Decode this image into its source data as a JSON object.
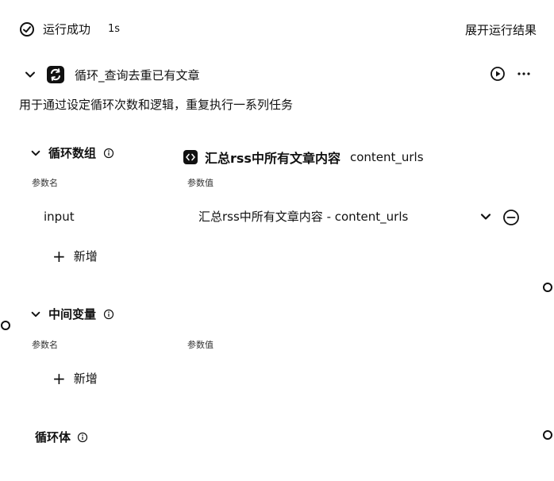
{
  "status": {
    "label": "运行成功",
    "duration": "1s",
    "expand_results": "展开运行结果"
  },
  "node": {
    "title": "循环_查询去重已有文章",
    "description": "用于通过设定循环次数和逻辑，重复执行一系列任务"
  },
  "loop_array": {
    "title": "循环数组",
    "param_name_header": "参数名",
    "param_value_header": "参数值",
    "tooltip_source": "汇总rss中所有文章内容",
    "tooltip_field": "content_urls",
    "rows": [
      {
        "name": "input",
        "value": "汇总rss中所有文章内容 - content_urls"
      }
    ],
    "add_label": "新增"
  },
  "intermediate_vars": {
    "title": "中间变量",
    "param_name_header": "参数名",
    "param_value_header": "参数值",
    "add_label": "新增"
  },
  "loop_body": {
    "title": "循环体"
  },
  "colors": {
    "text": "#111111",
    "background": "#ffffff"
  },
  "icons": {
    "status": "check-circle-icon",
    "node": "loop-icon",
    "run": "play-circle-icon",
    "more": "more-horizontal-icon",
    "collapse": "chevron-down-icon",
    "info": "info-icon",
    "remove": "minus-circle-icon",
    "add": "plus-icon",
    "source": "code-block-icon"
  }
}
